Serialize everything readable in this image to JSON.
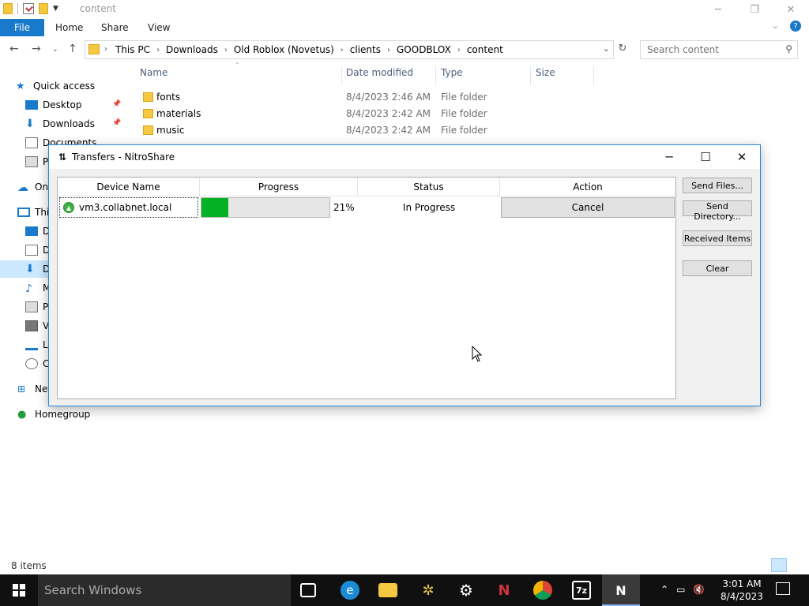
{
  "explorer": {
    "title": "content",
    "ribbon_tabs": [
      "File",
      "Home",
      "Share",
      "View"
    ],
    "breadcrumbs": [
      "This PC",
      "Downloads",
      "Old Roblox (Novetus)",
      "clients",
      "GOODBLOX",
      "content"
    ],
    "search_placeholder": "Search content",
    "columns": [
      "Name",
      "Date modified",
      "Type",
      "Size"
    ],
    "files": [
      {
        "name": "fonts",
        "date": "8/4/2023 2:46 AM",
        "type": "File folder"
      },
      {
        "name": "materials",
        "date": "8/4/2023 2:42 AM",
        "type": "File folder"
      },
      {
        "name": "music",
        "date": "8/4/2023 2:42 AM",
        "type": "File folder"
      }
    ],
    "nav": {
      "quick_access": "Quick access",
      "desktop": "Desktop",
      "downloads": "Downloads",
      "documents": "Documents",
      "p1": "P",
      "onedrive": "On",
      "thispc": "Thi",
      "d1": "D",
      "d2": "D",
      "d3": "D",
      "m": "M",
      "p2": "P",
      "v": "V",
      "l": "Lo",
      "c": "C",
      "network": "Net",
      "homegroup": "Homegroup"
    },
    "status": "8 items"
  },
  "dialog": {
    "title": "Transfers - NitroShare",
    "columns": [
      "Device Name",
      "Progress",
      "Status",
      "Action"
    ],
    "transfer": {
      "device": "vm3.collabnet.local",
      "progress": 0.21,
      "progress_label": "21%",
      "status": "In Progress",
      "action": "Cancel"
    },
    "buttons": {
      "send_files": "Send Files...",
      "send_directory": "Send Directory...",
      "received_items": "Received Items",
      "clear": "Clear"
    }
  },
  "taskbar": {
    "search_placeholder": "Search Windows",
    "time": "3:01 AM",
    "date": "8/4/2023"
  }
}
